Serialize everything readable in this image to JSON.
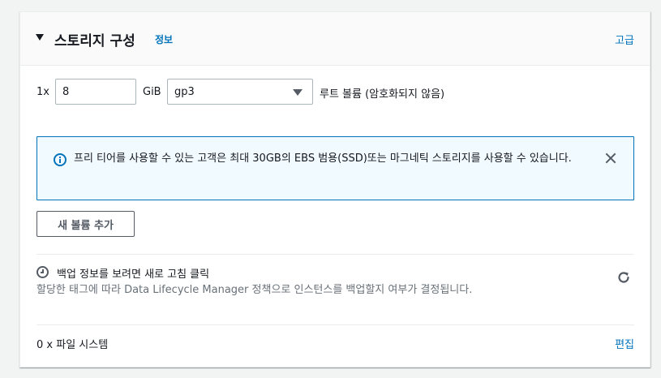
{
  "section": {
    "title": "스토리지 구성",
    "info_link": "정보",
    "advanced_link": "고급"
  },
  "volume": {
    "multiplier": "1x",
    "size_value": "8",
    "unit": "GiB",
    "type_selected": "gp3",
    "description": "루트 볼륨  (암호화되지 않음)"
  },
  "alert": {
    "message": "프리 티어를 사용할 수 있는 고객은 최대 30GB의 EBS 범용(SSD)또는 마그네틱 스토리지를 사용할 수 있습니다."
  },
  "add_volume_button": "새 볼륨 추가",
  "backup": {
    "title": "백업 정보를 보려면 새로 고침 클릭",
    "description": "할당한 태그에 따라 Data Lifecycle Manager 정책으로 인스턴스를 백업할지 여부가 결정됩니다."
  },
  "file_systems": {
    "label": "0 x 파일 시스템",
    "edit_link": "편집"
  },
  "colors": {
    "link": "#0073bb",
    "alert_bg": "#f1faff",
    "alert_border": "#0073bb",
    "muted_text": "#687078"
  },
  "icons": {
    "collapse": "caret-down-icon",
    "info": "info-icon",
    "close": "close-icon",
    "clock": "clock-icon",
    "refresh": "refresh-icon"
  }
}
